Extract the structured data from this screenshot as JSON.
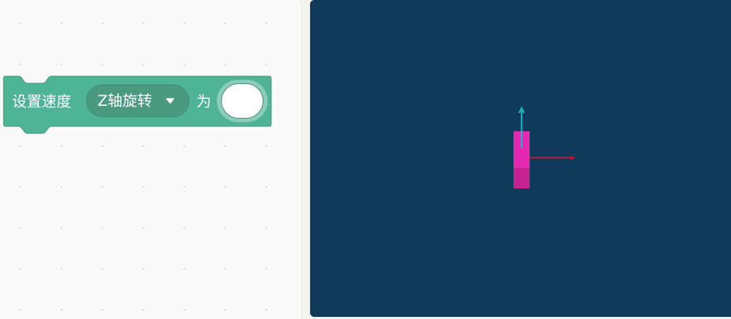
{
  "block": {
    "label": "设置速度",
    "dropdown_value": "Z轴旋转",
    "suffix": "为",
    "input_value": "",
    "color": "#4fb395",
    "dropdown_color": "#4a9a80"
  },
  "stage": {
    "background": "#0f3a59",
    "object_color": "#e428b0",
    "y_axis_color": "#17c3c8",
    "x_axis_color": "#c8102e"
  }
}
